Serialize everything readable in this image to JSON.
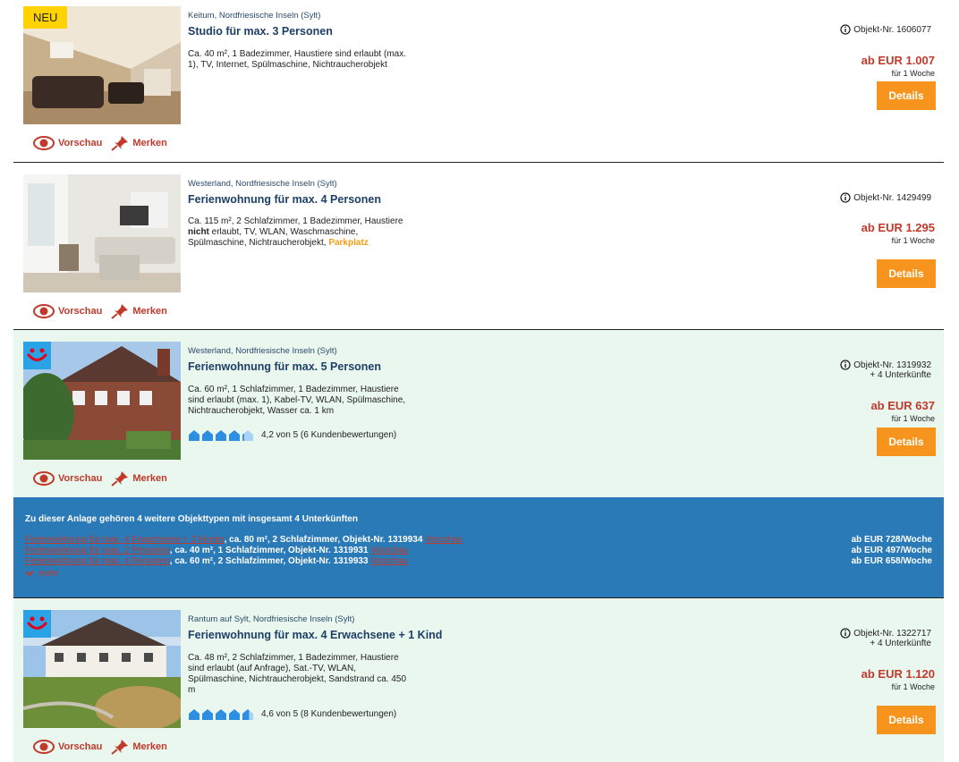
{
  "actions": {
    "preview": "Vorschau",
    "bookmark": "Merken",
    "details": "Details"
  },
  "listings": [
    {
      "badge": "NEU",
      "location": "Keitum, Nordfriesische Inseln (Sylt)",
      "title": "Studio für max. 3 Personen",
      "desc_lines": [
        "Ca. 40 m², 1 Badezimmer, Haustiere sind erlaubt (max.",
        "1), TV, Internet, Spülmaschine, Nichtraucherobjekt"
      ],
      "object_nr": "Objekt-Nr. 1606077",
      "price": "ab EUR 1.007",
      "period": "für 1 Woche"
    },
    {
      "location": "Westerland, Nordfriesische Inseln (Sylt)",
      "title": "Ferienwohnung für max. 4 Personen",
      "desc_line1": "Ca. 115 m², 2 Schlafzimmer, 1 Badezimmer, Haustiere",
      "desc_bold": "nicht",
      "desc_line2_rest": " erlaubt, TV, WLAN, Waschmaschine,",
      "desc_line3": "Spülmaschine, Nichtraucherobjekt, ",
      "desc_highlight": "Parkplatz",
      "object_nr": "Objekt-Nr. 1429499",
      "price": "ab EUR 1.295",
      "period": "für 1 Woche"
    },
    {
      "location": "Westerland, Nordfriesische Inseln (Sylt)",
      "title": "Ferienwohnung für max. 5 Personen",
      "desc_lines": [
        "Ca. 60 m², 1 Schlafzimmer, 1 Badezimmer, Haustiere",
        "sind erlaubt (max. 1), Kabel-TV, WLAN, Spülmaschine,",
        "Nichtraucherobjekt, Wasser ca. 1 km"
      ],
      "rating_value": 4.2,
      "rating_text": "4,2 von 5 (6 Kundenbewertungen)",
      "object_nr": "Objekt-Nr. 1319932",
      "units": "+ 4 Unterkünfte",
      "price": "ab EUR 637",
      "period": "für 1 Woche"
    },
    {
      "location": "Rantum auf Sylt, Nordfriesische Inseln (Sylt)",
      "title": "Ferienwohnung für max. 4 Erwachsene + 1 Kind",
      "desc_lines": [
        "Ca. 48 m², 2 Schlafzimmer, 1 Badezimmer, Haustiere",
        "sind erlaubt (auf Anfrage), Sat.-TV, WLAN,",
        "Spülmaschine, Nichtraucherobjekt, Sandstrand ca. 450",
        "m"
      ],
      "rating_value": 4.6,
      "rating_text": "4,6 von 5 (8 Kundenbewertungen)",
      "object_nr": "Objekt-Nr. 1322717",
      "units": "+ 4 Unterkünfte",
      "price": "ab EUR 1.120",
      "period": "für 1 Woche"
    }
  ],
  "complex": {
    "heading": "Zu dieser Anlage gehören 4 weitere Objekttypen mit insgesamt 4 Unterkünften",
    "rows": [
      {
        "link": "Ferienwohnung für max. 4 Erwachsene + 2 Kinder",
        "info": ", ca. 80 m², 2 Schlafzimmer, Objekt-Nr. 1319934 ",
        "preview": "Vorschau",
        "price": "ab EUR 728/Woche"
      },
      {
        "link": "Ferienwohnung für max. 2 Personen",
        "info": ", ca. 40 m², 1 Schlafzimmer, Objekt-Nr. 1319931 ",
        "preview": "Vorschau",
        "price": "ab EUR 497/Woche"
      },
      {
        "link": "Ferienwohnung für max. 4 Personen",
        "info": ", ca. 60 m², 2 Schlafzimmer, Objekt-Nr. 1319933 ",
        "preview": "Vorschau",
        "price": "ab EUR 658/Woche"
      }
    ],
    "more": "mehr"
  },
  "colors": {
    "accent_red": "#c0392b",
    "details_orange": "#f7941d",
    "complex_blue": "#2a7ab8",
    "alt_row_green": "#e9f7ef",
    "title_blue": "#1e3f66"
  }
}
